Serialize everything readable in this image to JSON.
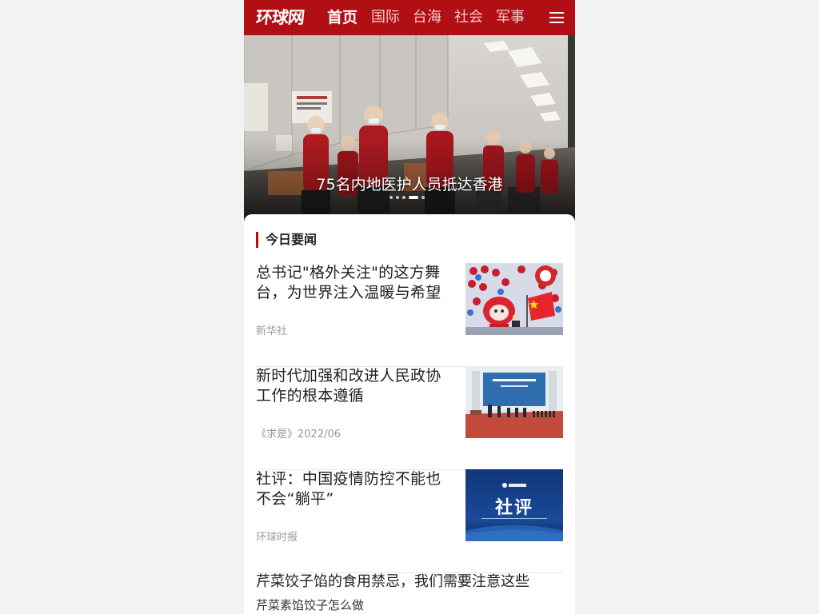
{
  "header": {
    "logo": "环球网",
    "nav": [
      "首页",
      "国际",
      "台海",
      "社会",
      "军事"
    ],
    "active_index": 0,
    "brand_color": "#b20f14"
  },
  "banner": {
    "caption": "75名内地医护人员抵达香港",
    "dot_count": 5,
    "active_dot": 3
  },
  "section": {
    "title": "今日要闻"
  },
  "articles": [
    {
      "title": "总书记\"格外关注\"的这方舞台，为世界注入温暖与希望",
      "source": "新华社"
    },
    {
      "title": "新时代加强和改进人民政协工作的根本遵循",
      "source": "《求是》2022/06"
    },
    {
      "title": "社评：中国疫情防控不能也不会“躺平”",
      "source": "环球时报",
      "thumb_text": "社评"
    }
  ],
  "plain_article": {
    "title": "芹菜饺子馅的食用禁忌，我们需要注意这些",
    "subtitle": "芹菜素馅饺子怎么做"
  }
}
